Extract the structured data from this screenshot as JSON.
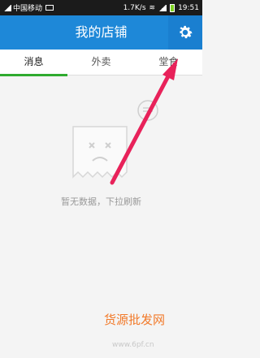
{
  "status_bar": {
    "carrier": "中国移动",
    "speed": "1.7K/s",
    "time": "19:51"
  },
  "header": {
    "title": "我的店铺"
  },
  "tabs": [
    {
      "label": "消息",
      "active": true
    },
    {
      "label": "外卖",
      "active": false
    },
    {
      "label": "堂食",
      "active": false
    }
  ],
  "empty_state": {
    "message": "暂无数据，下拉刷新"
  },
  "watermark": {
    "text": "货源批发网",
    "url": "www.6pf.cn"
  },
  "colors": {
    "app_bar": "#1e88d8",
    "tab_indicator": "#2fab2f",
    "arrow": "#e8225a"
  }
}
